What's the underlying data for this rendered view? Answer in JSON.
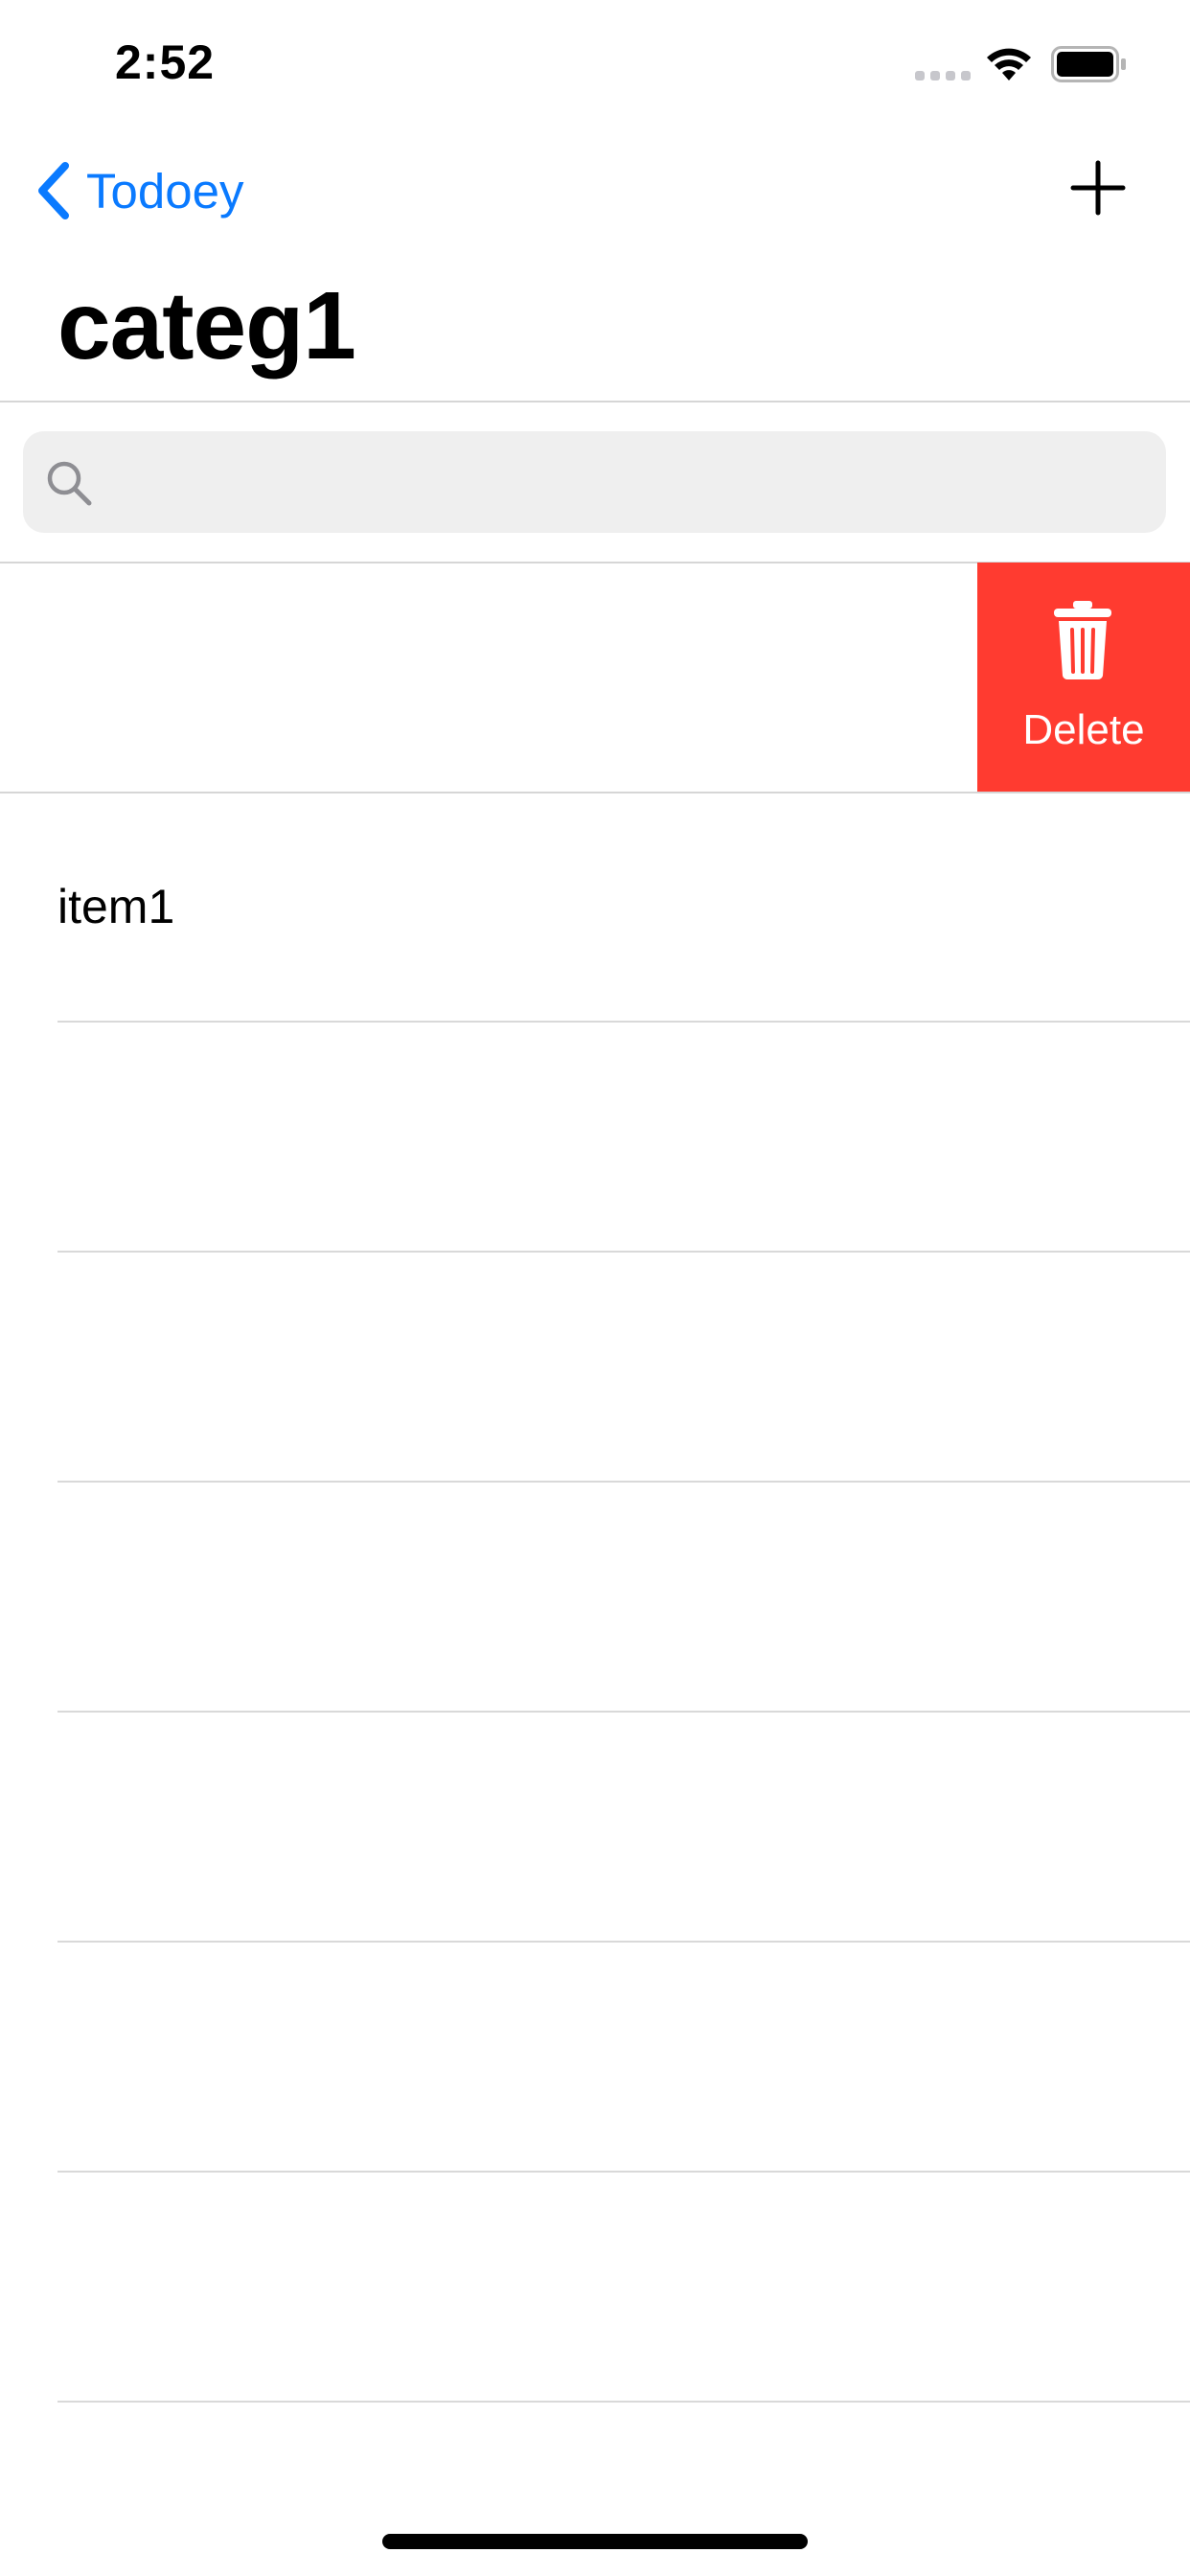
{
  "status_bar": {
    "time": "2:52",
    "icons": [
      "signal-dots",
      "wifi-icon",
      "battery-icon"
    ]
  },
  "nav": {
    "back_label": "Todoey",
    "back_icon": "chevron-left-icon",
    "add_icon": "plus-icon",
    "title": "categ1",
    "accent_color": "#0a7aff"
  },
  "search": {
    "placeholder": "",
    "value": "",
    "icon": "search-icon"
  },
  "table": {
    "rows": [
      {
        "label": "",
        "swiped": true
      },
      {
        "label": "item1"
      },
      {
        "label": ""
      },
      {
        "label": ""
      },
      {
        "label": ""
      },
      {
        "label": ""
      },
      {
        "label": ""
      },
      {
        "label": ""
      }
    ],
    "swipe_action": {
      "label": "Delete",
      "icon": "trash-icon",
      "color": "#ff3b30"
    }
  }
}
